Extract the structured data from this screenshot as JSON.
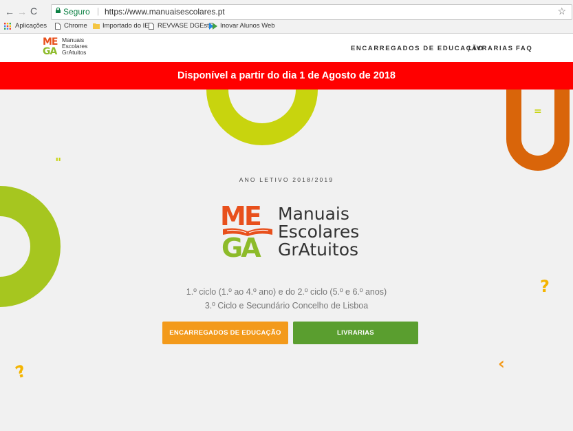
{
  "browser": {
    "secure_label": "Seguro",
    "url": "https://www.manuaisescolares.pt",
    "bookmarks": [
      "Aplicações",
      "Chrome",
      "Importado do IE",
      "REVVASE DGEstE",
      "Inovar Alunos Web"
    ]
  },
  "header": {
    "logo_lines": [
      "Manuais",
      "Escolares",
      "GrAtuitos"
    ],
    "logo_letters": {
      "top": "ME",
      "bottom": "GA"
    },
    "nav": [
      "ENCARREGADOS DE EDUCAÇÃO",
      "LIVRARIAS",
      "FAQ"
    ]
  },
  "banner": {
    "text": "Disponível a partir do dia 1 de Agosto de 2018"
  },
  "hero": {
    "year": "ANO LETIVO 2018/2019",
    "logo_lines": [
      "Manuais",
      "Escolares",
      "GrAtuitos"
    ],
    "logo_letters": {
      "top": "ME",
      "bottom": "GA"
    },
    "subtitle1": "1.º ciclo (1.º ao 4.º ano) e do 2.º ciclo (5.º e 6.º anos)",
    "subtitle2": "3.º Ciclo e Secundário Concelho de Lisboa",
    "buttons": {
      "parents": "ENCARREGADOS DE EDUCAÇÃO",
      "bookstores": "LIVRARIAS"
    },
    "decorations": {
      "quote": "\"",
      "equals": "=",
      "question": "?",
      "chevron": "‹"
    }
  },
  "colors": {
    "banner": "#ff0000",
    "orange": "#f39a1b",
    "green": "#5a9e2f",
    "lime": "#c8d40e",
    "rust": "#d9650a"
  }
}
